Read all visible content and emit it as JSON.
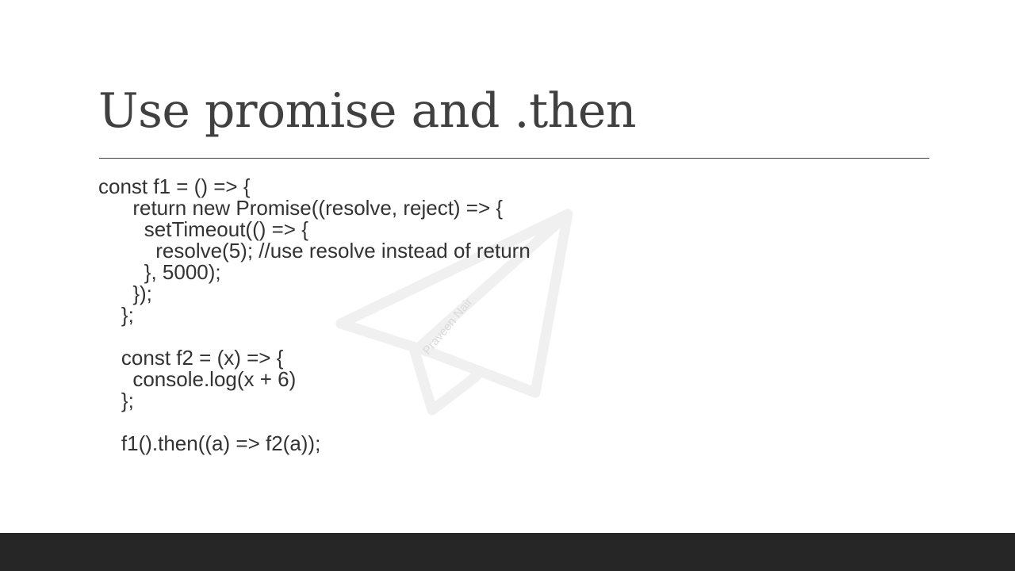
{
  "slide": {
    "title": "Use promise and .then",
    "watermark_text": "Praveen Nair",
    "code_lines": [
      "const f1 = () => {",
      "      return new Promise((resolve, reject) => {",
      "        setTimeout(() => {",
      "          resolve(5); //use resolve instead of return",
      "        }, 5000);",
      "      });",
      "    };",
      "",
      "    const f2 = (x) => {",
      "      console.log(x + 6)",
      "    };",
      "",
      "    f1().then((a) => f2(a));"
    ]
  },
  "colors": {
    "title": "#404040",
    "text": "#333333",
    "rule": "#404040",
    "footer": "#262626",
    "watermark": "#f0f0f0",
    "watermark_text": "#d9d9d9"
  },
  "icons": {
    "watermark": "paper-plane-icon"
  }
}
